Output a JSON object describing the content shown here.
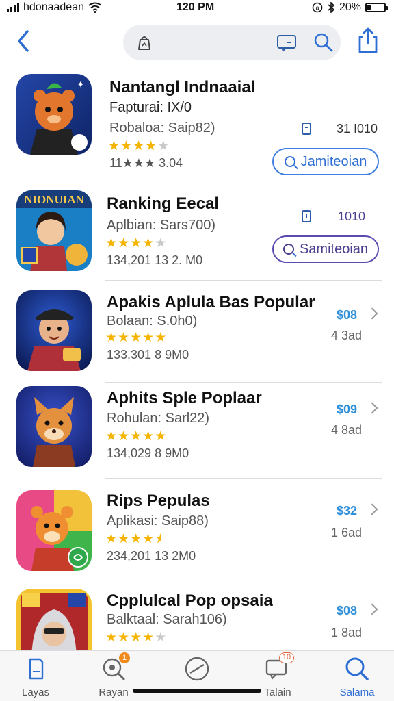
{
  "status_bar": {
    "carrier": "hdonaadean",
    "time": "120 PM",
    "battery": "20%",
    "battery_level": 0.2
  },
  "nav": {
    "back_icon": "chevron-left-icon",
    "search_icons": [
      "app-clip-icon",
      "message-box-icon",
      "search-icon"
    ],
    "share_icon": "share-icon"
  },
  "apps": [
    {
      "name": "Nantangl Indnaaial",
      "line2": "Fapturai: IX/0",
      "line3": "Robaloa: Saip82)",
      "rating": 4,
      "meta": "11★★★ 3.04",
      "value": "31 I010",
      "button": "Jamiteoian",
      "colors": [
        "#1b3f8f",
        "#f4a338"
      ]
    },
    {
      "name": "Ranking Eecal",
      "line2": "Aplbian: Sars700)",
      "rating": 4,
      "meta": "134,201 13 2. M0",
      "value": "1010",
      "button": "Samiteoian",
      "banner": "NIONUIAN",
      "colors": [
        "#1a7fc4",
        "#f7c94a"
      ]
    },
    {
      "name": "Apakis Aplula Bas Popular",
      "line2": "Bolaan: S.0h0)",
      "rating": 5,
      "meta": "133,301 8 9M0",
      "price": "$08",
      "size": "4 3ad",
      "colors": [
        "#152c7a",
        "#c0392b"
      ]
    },
    {
      "name": "Aphits Sple Poplaar",
      "line2": "Rohulan: Sarl22)",
      "rating": 5,
      "meta": "134,029 8 9M0",
      "price": "$09",
      "size": "4 8ad",
      "colors": [
        "#2b3fb0",
        "#e9903a"
      ]
    },
    {
      "name": "Rips Pepulas",
      "line2": "Aplikasi: Saip88)",
      "rating": 4.5,
      "meta": "234,201 13 2M0",
      "price": "$32",
      "size": "1 6ad",
      "colors": [
        "#e94a8a",
        "#f4b340"
      ]
    },
    {
      "name": "Cpplulcal Pop opsaia",
      "line2": "Balktaal: Sarah106)",
      "rating": 4,
      "meta": "",
      "price": "$08",
      "size": "1 8ad",
      "colors": [
        "#c0392b",
        "#f7d14a"
      ]
    }
  ],
  "tabs": [
    {
      "label": "Layas",
      "icon": "document-icon",
      "active": false
    },
    {
      "label": "Rayan",
      "icon": "search-badge-icon",
      "active": false,
      "badge": "1"
    },
    {
      "label": "",
      "icon": "compass-icon",
      "active": false
    },
    {
      "label": "Talain",
      "icon": "chat-icon",
      "active": false,
      "badge": "10"
    },
    {
      "label": "Salama",
      "icon": "search-icon",
      "active": true
    }
  ]
}
